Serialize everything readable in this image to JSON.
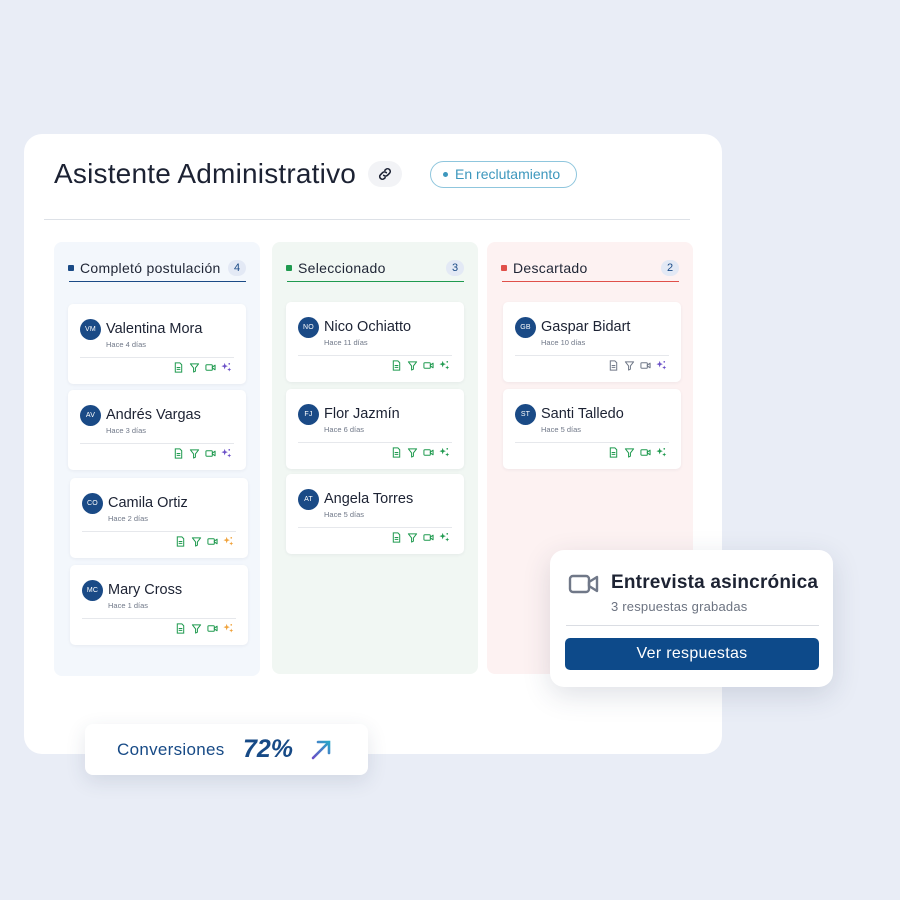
{
  "job": {
    "title": "Asistente Administrativo",
    "status": "En reclutamiento"
  },
  "columns": [
    {
      "title": "Completó postulación",
      "count": "4",
      "accent": "#1a4a86",
      "candidates": [
        {
          "initials": "VM",
          "name": "Valentina Mora",
          "time": "Hace 4 días",
          "ai_color": "#6a4fc7"
        },
        {
          "initials": "AV",
          "name": "Andrés Vargas",
          "time": "Hace 3 días",
          "ai_color": "#6a4fc7"
        },
        {
          "initials": "CO",
          "name": "Camila Ortiz",
          "time": "Hace 2 días",
          "ai_color": "#f0a23a"
        },
        {
          "initials": "MC",
          "name": "Mary Cross",
          "time": "Hace 1 días",
          "ai_color": "#f0a23a"
        }
      ]
    },
    {
      "title": "Seleccionado",
      "count": "3",
      "accent": "#1f9a4f",
      "candidates": [
        {
          "initials": "NO",
          "name": "Nico Ochiatto",
          "time": "Hace 11 días",
          "ai_color": "#1f9a4f"
        },
        {
          "initials": "FJ",
          "name": "Flor Jazmín",
          "time": "Hace 6 días",
          "ai_color": "#1f9a4f"
        },
        {
          "initials": "AT",
          "name": "Angela Torres",
          "time": "Hace 5 días",
          "ai_color": "#1f9a4f"
        }
      ]
    },
    {
      "title": "Descartado",
      "count": "2",
      "accent": "#e0504a",
      "candidates": [
        {
          "initials": "GB",
          "name": "Gaspar Bidart",
          "time": "Hace 10 días",
          "ai_color": "#6a4fc7"
        },
        {
          "initials": "ST",
          "name": "Santi Talledo",
          "time": "Hace 5 días",
          "ai_color": "#1f9a4f"
        }
      ]
    }
  ],
  "interview": {
    "title": "Entrevista asincrónica",
    "subtitle": "3 respuestas grabadas",
    "button": "Ver respuestas"
  },
  "conversions": {
    "label": "Conversiones",
    "value": "72%"
  },
  "colors": {
    "primary": "#0d4a8a",
    "status": "#3d97bd",
    "icon_green": "#1f9a4f",
    "icon_gray": "#707888"
  }
}
